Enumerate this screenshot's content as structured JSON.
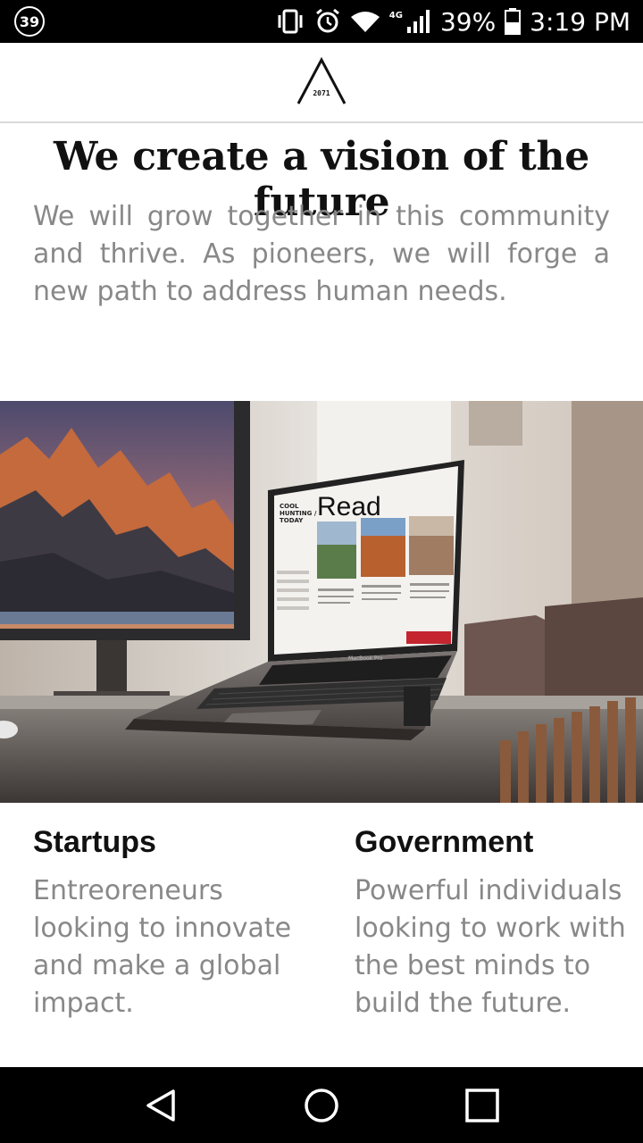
{
  "status_bar": {
    "notification_count": "39",
    "network_label": "4G",
    "battery": "39%",
    "time": "3:19 PM",
    "icons": [
      "vibrate-icon",
      "alarm-icon",
      "wifi-icon",
      "signal-icon",
      "battery-icon"
    ]
  },
  "header": {
    "logo_text": "2071"
  },
  "hero": {
    "title": "We create a vision of the future",
    "body": "We will grow together in this community and thrive. As pioneers, we will forge a new path to address human needs."
  },
  "image": {
    "laptop_screen": {
      "brand": "COOL HUNTING / TODAY",
      "heading": "Read"
    },
    "laptop_label": "MacBook Pro"
  },
  "columns": [
    {
      "title": "Startups",
      "text": "Entreoreneurs looking to innovate and make a global impact."
    },
    {
      "title": "Government",
      "text": "Powerful individuals looking to work with the best minds to build the future."
    }
  ],
  "nav": {
    "icons": [
      "back-icon",
      "home-icon",
      "recents-icon"
    ]
  },
  "colors": {
    "title": "#111111",
    "body_text": "#888888",
    "bars": "#000000",
    "divider": "#d9d9d9"
  }
}
